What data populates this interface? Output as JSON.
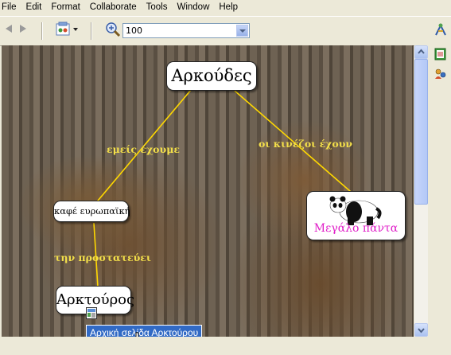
{
  "menu": [
    "File",
    "Edit",
    "Format",
    "Collaborate",
    "Tools",
    "Window",
    "Help"
  ],
  "toolbar": {
    "back_icon": "back-arrow-icon",
    "forward_icon": "forward-arrow-icon",
    "layout_icon": "layout-icon",
    "zoom_icon": "zoom-icon",
    "zoom_value": "100",
    "right_icon": "collab-icon"
  },
  "side_icons": [
    "notes-icon",
    "people-icon"
  ],
  "map": {
    "center": "Αρκούδες",
    "links": [
      "εμείς έχουμε",
      "οι κινέζοι έχουν",
      "την προστατεύει"
    ],
    "europe_topic": "καφέ ευρωπαϊκή",
    "panda_topic": "Μεγάλο πάντα",
    "arktouros_topic": "Αρκτούρος",
    "tooltip": "Αρχική σελίδα Αρκτούρου"
  },
  "colors": {
    "link_line": "#ffd800",
    "link_text": "#f3df4a",
    "panda_text": "#e01ec8",
    "tooltip_bg": "#316ac5"
  }
}
